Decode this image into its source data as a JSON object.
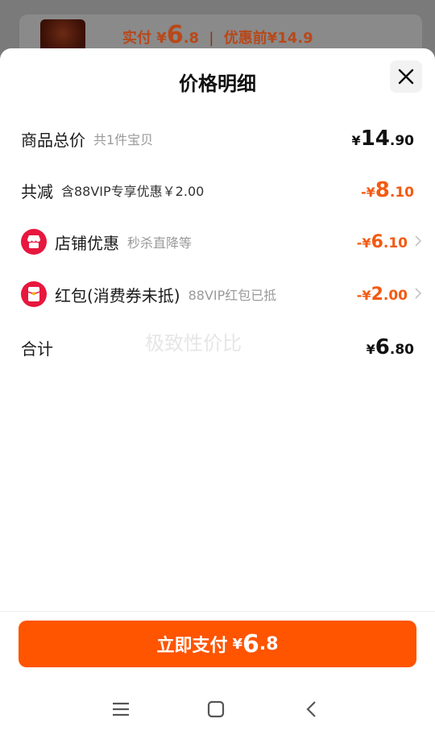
{
  "background": {
    "paid_label": "实付",
    "paid_currency": "¥",
    "paid_int": "6",
    "paid_dec": ".8",
    "separator": "|",
    "before_label": "优惠前",
    "before_price": "¥14.9"
  },
  "sheet": {
    "title": "价格明细",
    "close_icon": "close-icon"
  },
  "rows": {
    "total": {
      "label": "商品总价",
      "sub": "共1件宝贝",
      "cur": "¥",
      "int": "14",
      "dec": ".90"
    },
    "reduce": {
      "label": "共减",
      "sub": "含88VIP专享优惠￥2.00",
      "cur": "-¥",
      "int": "8",
      "dec": ".10"
    },
    "shop": {
      "label": "店铺优惠",
      "sub": "秒杀直降等",
      "cur": "-¥",
      "int": "6",
      "dec": ".10",
      "icon": "shop-icon"
    },
    "redpacket": {
      "label": "红包(消费券未抵)",
      "sub": "88VIP红包已抵",
      "cur": "-¥",
      "int": "2",
      "dec": ".00",
      "icon": "red-packet-icon"
    },
    "sum": {
      "label": "合计",
      "cur": "¥",
      "int": "6",
      "dec": ".80"
    }
  },
  "watermark": "极致性价比",
  "pay_button": {
    "label": "立即支付",
    "cur": "¥",
    "int": "6",
    "dec": ".8"
  },
  "navbar": {
    "icons": [
      "menu-icon",
      "home-icon",
      "back-icon"
    ]
  },
  "colors": {
    "accent": "#ff5400",
    "discount": "#f35a12",
    "icon_red": "#e7173e"
  }
}
